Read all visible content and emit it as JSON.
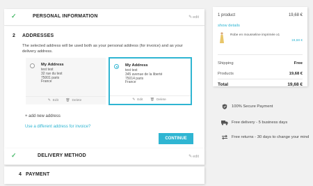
{
  "steps": {
    "personal": {
      "title": "PERSONAL INFORMATION",
      "edit": "edit"
    },
    "addresses": {
      "number": "2",
      "title": "ADDRESSES",
      "intro": "The selected address will be used both as your personal address (for invoice) and as your delivery address.",
      "addresses": [
        {
          "name": "My Address",
          "lines": [
            "test test",
            "32 rue du test",
            "75001 paris",
            "France"
          ],
          "edit": "Edit",
          "delete": "Delete",
          "selected": false
        },
        {
          "name": "My Address",
          "lines": [
            "test test",
            "345 avenue de la liberté",
            "75014 paris",
            "France"
          ],
          "edit": "Edit",
          "delete": "Delete",
          "selected": true
        }
      ],
      "add_new": "+ add new address",
      "different_invoice": "Use a different address for invoice?",
      "continue": "CONTINUE"
    },
    "delivery": {
      "title": "DELIVERY METHOD",
      "edit": "edit"
    },
    "payment": {
      "number": "4",
      "title": "PAYMENT"
    }
  },
  "summary": {
    "count": "1 product",
    "count_total": "19,68 €",
    "show_details": "show details",
    "product": {
      "name": "Robe en mousseline imprimée x1",
      "price": "19,68 €"
    },
    "shipping_label": "Shipping",
    "shipping_value": "Free",
    "products_label": "Products",
    "products_value": "19,68 €",
    "total_label": "Total",
    "total_value": "19,68 €"
  },
  "reassurance": [
    {
      "icon": "shield-icon",
      "text": "100% Secure Payment"
    },
    {
      "icon": "truck-icon",
      "text": "Free delivery - 5 business days"
    },
    {
      "icon": "return-arrows-icon",
      "text": "Free returns - 30 days to change your mind"
    }
  ],
  "colors": {
    "accent": "#2fb5d2",
    "check": "#4cbb6c",
    "background": "#f1f1f1"
  }
}
